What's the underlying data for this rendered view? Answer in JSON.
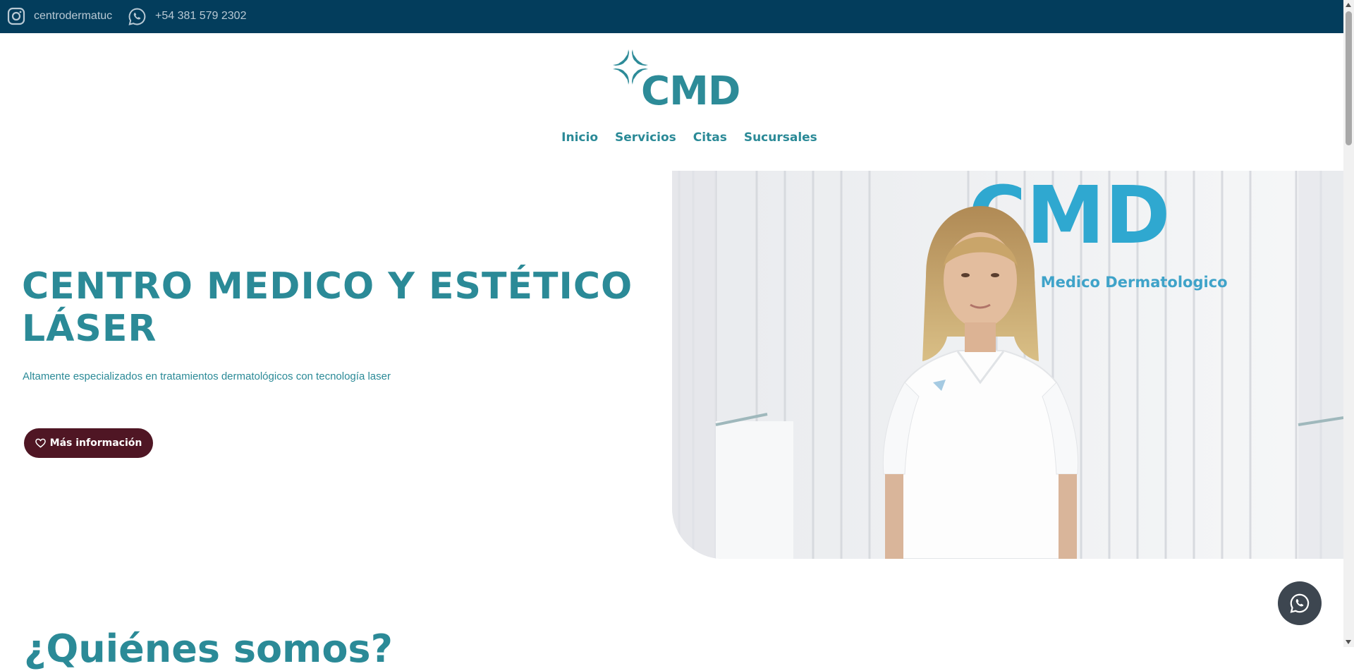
{
  "topbar": {
    "instagram_handle": "centrodermatuc",
    "phone": "+54 381 579 2302",
    "bg_color": "#033d5c"
  },
  "logo": {
    "text": "CMD"
  },
  "nav": {
    "items": [
      {
        "label": "Inicio"
      },
      {
        "label": "Servicios"
      },
      {
        "label": "Citas"
      },
      {
        "label": "Sucursales"
      }
    ]
  },
  "hero": {
    "title": "CENTRO MEDICO Y ESTÉTICO LÁSER",
    "subtitle": "Altamente especializados en tratamientos dermatológicos con tecnología laser",
    "cta_label": "Más información",
    "photo_sign_logo": "CMD",
    "photo_sign_text": "Centro Medico Dermatologico"
  },
  "next_section": {
    "title": "¿Quiénes somos?"
  },
  "icons": [
    "instagram-icon",
    "whatsapp-icon",
    "heart-icon",
    "whatsapp-float-icon"
  ],
  "colors": {
    "accent": "#2b8a97",
    "cta": "#4f1624",
    "float_button": "#3d4650"
  }
}
